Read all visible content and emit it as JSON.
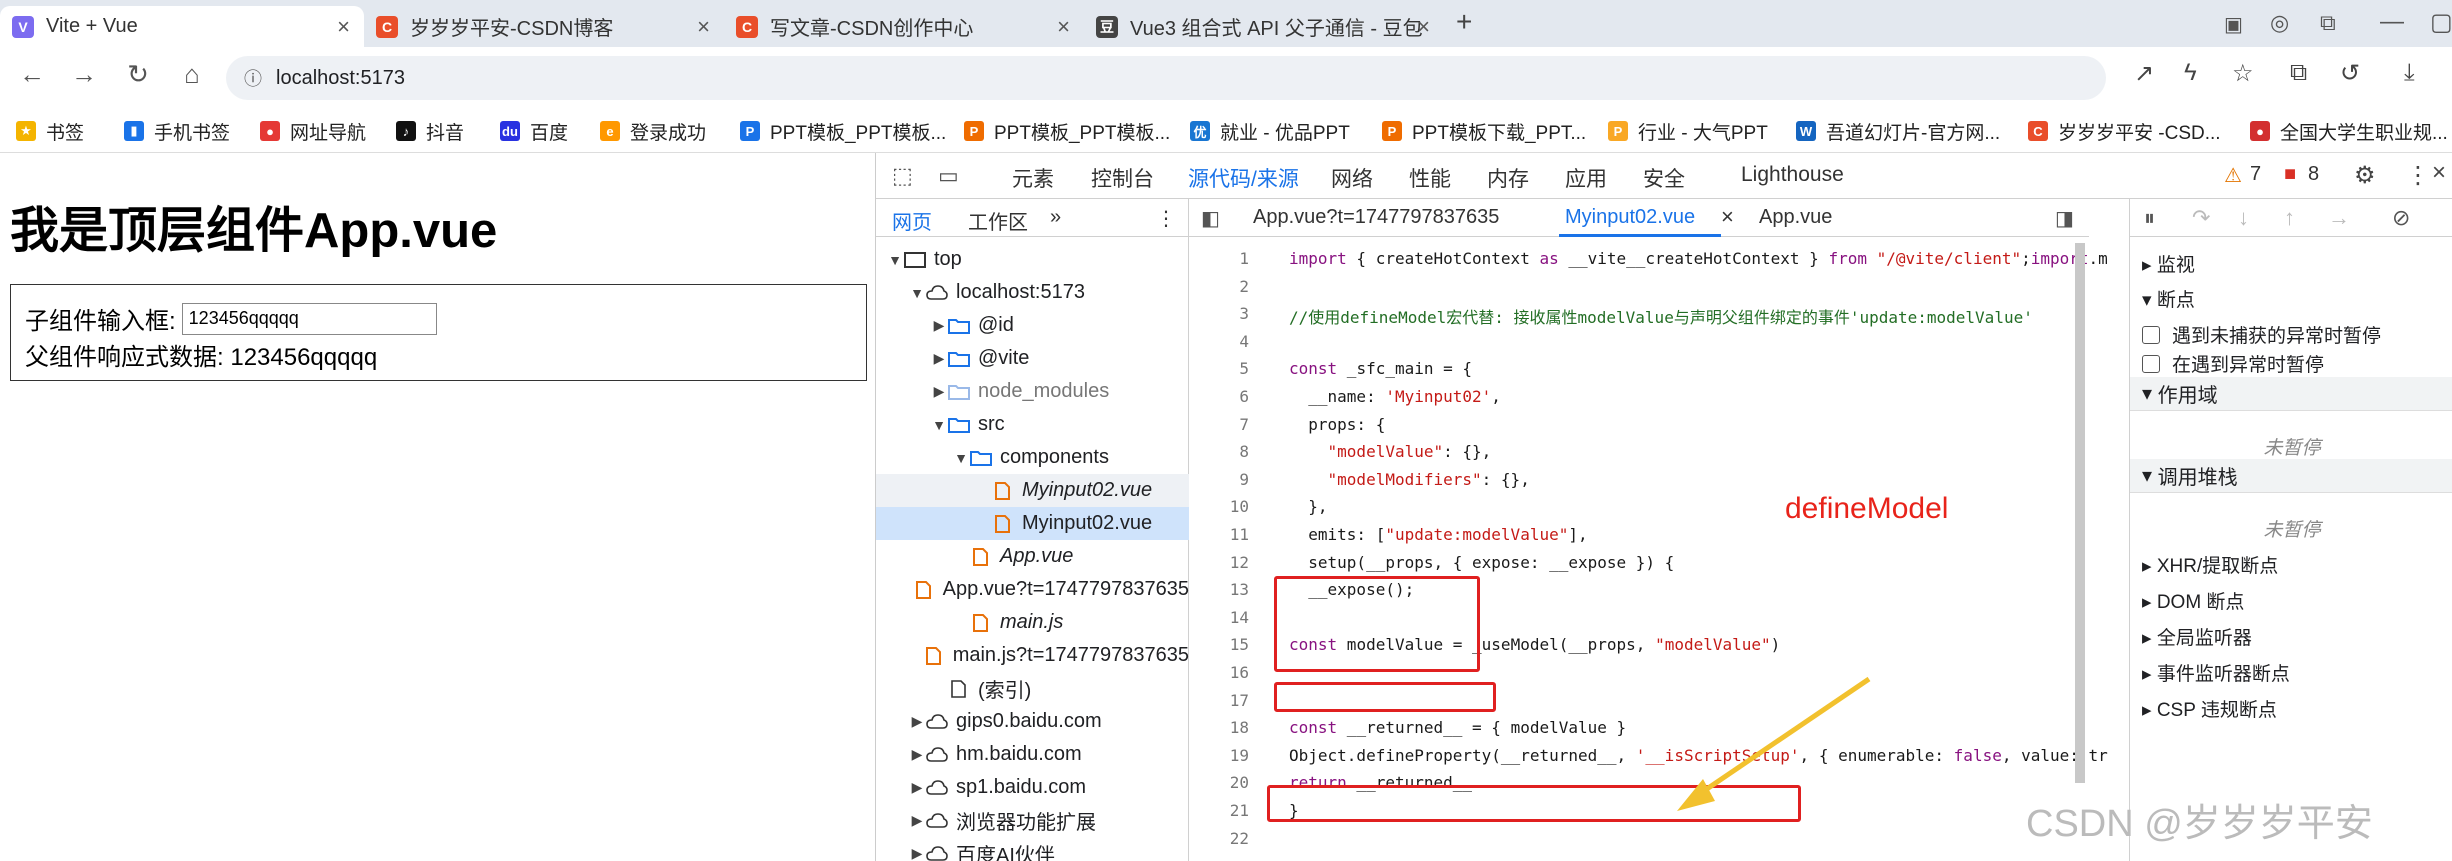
{
  "browser_tabs": [
    {
      "title": "Vite + Vue",
      "active": true,
      "color": "#7c6cf0",
      "glyph": "V"
    },
    {
      "title": "岁岁岁平安-CSDN博客",
      "active": false,
      "color": "#e94e2a",
      "glyph": "C"
    },
    {
      "title": "写文章-CSDN创作中心",
      "active": false,
      "color": "#e94e2a",
      "glyph": "C"
    },
    {
      "title": "Vue3 组合式 API 父子通信 - 豆包",
      "active": false,
      "color": "#444",
      "glyph": "豆"
    }
  ],
  "url": "localhost:5173",
  "bookmarks": [
    {
      "label": "书签",
      "color": "#f4b400"
    },
    {
      "label": "手机书签",
      "color": "#1a73e8"
    },
    {
      "label": "网址导航",
      "color": "#e53935"
    },
    {
      "label": "抖音",
      "color": "#111"
    },
    {
      "label": "百度",
      "color": "#2932e1"
    },
    {
      "label": "登录成功",
      "color": "#ff9800"
    },
    {
      "label": "PPT模板_PPT模板...",
      "color": "#1a73e8"
    },
    {
      "label": "PPT模板_PPT模板...",
      "color": "#ef6c00"
    },
    {
      "label": "就业 - 优品PPT",
      "color": "#1976d2"
    },
    {
      "label": "PPT模板下载_PPT...",
      "color": "#ef6c00"
    },
    {
      "label": "行业 - 大气PPT",
      "color": "#f9a825"
    },
    {
      "label": "吾道幻灯片-官方网...",
      "color": "#1565c0"
    },
    {
      "label": "岁岁岁平安 -CSD...",
      "color": "#e94e2a"
    },
    {
      "label": "全国大学生职业规...",
      "color": "#d32f2f"
    }
  ],
  "page": {
    "heading": "我是顶层组件App.vue",
    "child_label": "子组件输入框:",
    "input_value": "123456qqqqq",
    "parent_label": "父组件响应式数据:",
    "parent_value": "123456qqqqq"
  },
  "devtools": {
    "tabs": [
      "元素",
      "控制台",
      "源代码/来源",
      "网络",
      "性能",
      "内存",
      "应用",
      "安全",
      "Lighthouse"
    ],
    "active_tab": "源代码/来源",
    "warnings": "7",
    "errors": "8",
    "navigator_tabs": [
      "网页",
      "工作区"
    ],
    "tree": [
      {
        "label": "top",
        "depth": 0,
        "arrow": "▼",
        "icon": "frame"
      },
      {
        "label": "localhost:5173",
        "depth": 1,
        "arrow": "▼",
        "icon": "cloud"
      },
      {
        "label": "@id",
        "depth": 2,
        "arrow": "▶",
        "icon": "folder"
      },
      {
        "label": "@vite",
        "depth": 2,
        "arrow": "▶",
        "icon": "folder"
      },
      {
        "label": "node_modules",
        "depth": 2,
        "arrow": "▶",
        "icon": "folder-dim"
      },
      {
        "label": "src",
        "depth": 2,
        "arrow": "▼",
        "icon": "folder"
      },
      {
        "label": "components",
        "depth": 3,
        "arrow": "▼",
        "icon": "folder"
      },
      {
        "label": "Myinput02.vue",
        "depth": 4,
        "arrow": "",
        "icon": "file",
        "italic": true,
        "state": "hov"
      },
      {
        "label": "Myinput02.vue",
        "depth": 4,
        "arrow": "",
        "icon": "file",
        "state": "sel"
      },
      {
        "label": "App.vue",
        "depth": 3,
        "arrow": "",
        "icon": "file",
        "italic": true
      },
      {
        "label": "App.vue?t=1747797837635",
        "depth": 3,
        "arrow": "",
        "icon": "file"
      },
      {
        "label": "main.js",
        "depth": 3,
        "arrow": "",
        "icon": "file",
        "italic": true
      },
      {
        "label": "main.js?t=1747797837635",
        "depth": 3,
        "arrow": "",
        "icon": "file"
      },
      {
        "label": "(索引)",
        "depth": 2,
        "arrow": "",
        "icon": "doc"
      },
      {
        "label": "gips0.baidu.com",
        "depth": 1,
        "arrow": "▶",
        "icon": "cloud"
      },
      {
        "label": "hm.baidu.com",
        "depth": 1,
        "arrow": "▶",
        "icon": "cloud"
      },
      {
        "label": "sp1.baidu.com",
        "depth": 1,
        "arrow": "▶",
        "icon": "cloud"
      },
      {
        "label": "浏览器功能扩展",
        "depth": 1,
        "arrow": "▶",
        "icon": "cloud"
      },
      {
        "label": "百度AI伙伴",
        "depth": 1,
        "arrow": "▶",
        "icon": "cloud"
      }
    ],
    "editor_tabs": [
      "App.vue?t=1747797837635",
      "Myinput02.vue",
      "App.vue"
    ],
    "active_editor_tab": "Myinput02.vue",
    "code_lines": [
      "import { createHotContext as __vite__createHotContext } from \"/@vite/client\";import.m",
      "",
      "//使用defineModel宏代替: 接收属性modelValue与声明父组件绑定的事件'update:modelValue'",
      "",
      "const _sfc_main = {",
      "  __name: 'Myinput02',",
      "  props: {",
      "    \"modelValue\": {},",
      "    \"modelModifiers\": {},",
      "  },",
      "  emits: [\"update:modelValue\"],",
      "  setup(__props, { expose: __expose }) {",
      "  __expose();",
      "",
      "const modelValue = _useModel(__props, \"modelValue\")",
      "",
      "",
      "const __returned__ = { modelValue }",
      "Object.defineProperty(__returned__, '__isScriptSetup', { enumerable: false, value: tr",
      "return __returned__",
      "}",
      ""
    ],
    "annotation": "defineModel",
    "debugger": {
      "watch": "监视",
      "breakpoints": "断点",
      "pause_uncaught": "遇到未捕获的异常时暂停",
      "pause_caught": "在遇到异常时暂停",
      "scope": "作用域",
      "not_paused_1": "未暂停",
      "call_stack": "调用堆栈",
      "not_paused_2": "未暂停",
      "xhr": "XHR/提取断点",
      "dom": "DOM 断点",
      "global": "全局监听器",
      "event": "事件监听器断点",
      "csp": "CSP 违规断点"
    }
  },
  "watermark": "CSDN @岁岁岁平安"
}
